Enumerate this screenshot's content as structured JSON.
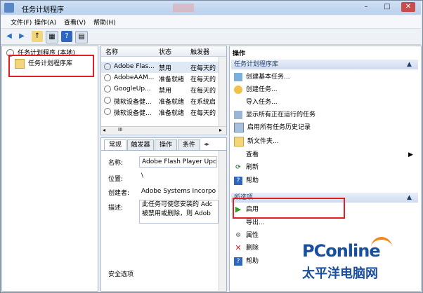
{
  "window": {
    "title": "任务计划程序",
    "controls": [
      "–",
      "□",
      "✕"
    ]
  },
  "menu": [
    "文件(F)",
    "操作(A)",
    "查看(V)",
    "帮助(H)"
  ],
  "tree": {
    "root": "任务计划程序 (本地)",
    "child": "任务计划程序库"
  },
  "task_list": {
    "columns": [
      "名称",
      "状态",
      "触发器"
    ],
    "rows": [
      {
        "name": "Adobe Flas...",
        "status": "禁用",
        "trigger": "在每天的"
      },
      {
        "name": "AdobeAAM...",
        "status": "准备就绪",
        "trigger": "在每天的"
      },
      {
        "name": "GoogleUp...",
        "status": "禁用",
        "trigger": "在每天的"
      },
      {
        "name": "微软设备健...",
        "status": "准备就绪",
        "trigger": "在系统启"
      },
      {
        "name": "微软设备健...",
        "status": "准备就绪",
        "trigger": "在每天的"
      }
    ],
    "scroll": "III"
  },
  "detail": {
    "tabs": [
      "常规",
      "触发器",
      "操作",
      "条件"
    ],
    "fields": [
      {
        "label": "名称:",
        "value": "Adobe Flash Player Upc"
      },
      {
        "label": "位置:",
        "value": "\\"
      },
      {
        "label": "创建者:",
        "value": "Adobe Systems Incorpo"
      }
    ],
    "desc_label": "描述:",
    "desc_value_1": "此任务可使您安装的 Adc",
    "desc_value_2": "被禁用或删除，则 Adob",
    "security": "安全选项"
  },
  "actions": {
    "title": "操作",
    "section1": "任务计划程序库",
    "items1": [
      {
        "icon": "create-basic-task-icon",
        "label": "创建基本任务..."
      },
      {
        "icon": "create-task-icon",
        "label": "创建任务..."
      },
      {
        "icon": "none",
        "label": "导入任务..."
      },
      {
        "icon": "show-running-icon",
        "label": "显示所有正在运行的任务"
      },
      {
        "icon": "history-icon",
        "label": "启用所有任务历史记录"
      },
      {
        "icon": "new-folder-icon",
        "label": "新文件夹..."
      },
      {
        "icon": "none",
        "label": "查看"
      },
      {
        "icon": "refresh-icon",
        "label": "刷新"
      },
      {
        "icon": "help-icon",
        "label": "帮助"
      }
    ],
    "section2": "所选项",
    "items2": [
      {
        "icon": "enable-icon",
        "label": "启用"
      },
      {
        "icon": "none",
        "label": "导出..."
      },
      {
        "icon": "properties-icon",
        "label": "属性"
      },
      {
        "icon": "delete-icon",
        "label": "删除"
      },
      {
        "icon": "help-icon",
        "label": "帮助"
      }
    ]
  },
  "watermark": {
    "brand": "PConline",
    "sub": "太平洋电脑网"
  }
}
